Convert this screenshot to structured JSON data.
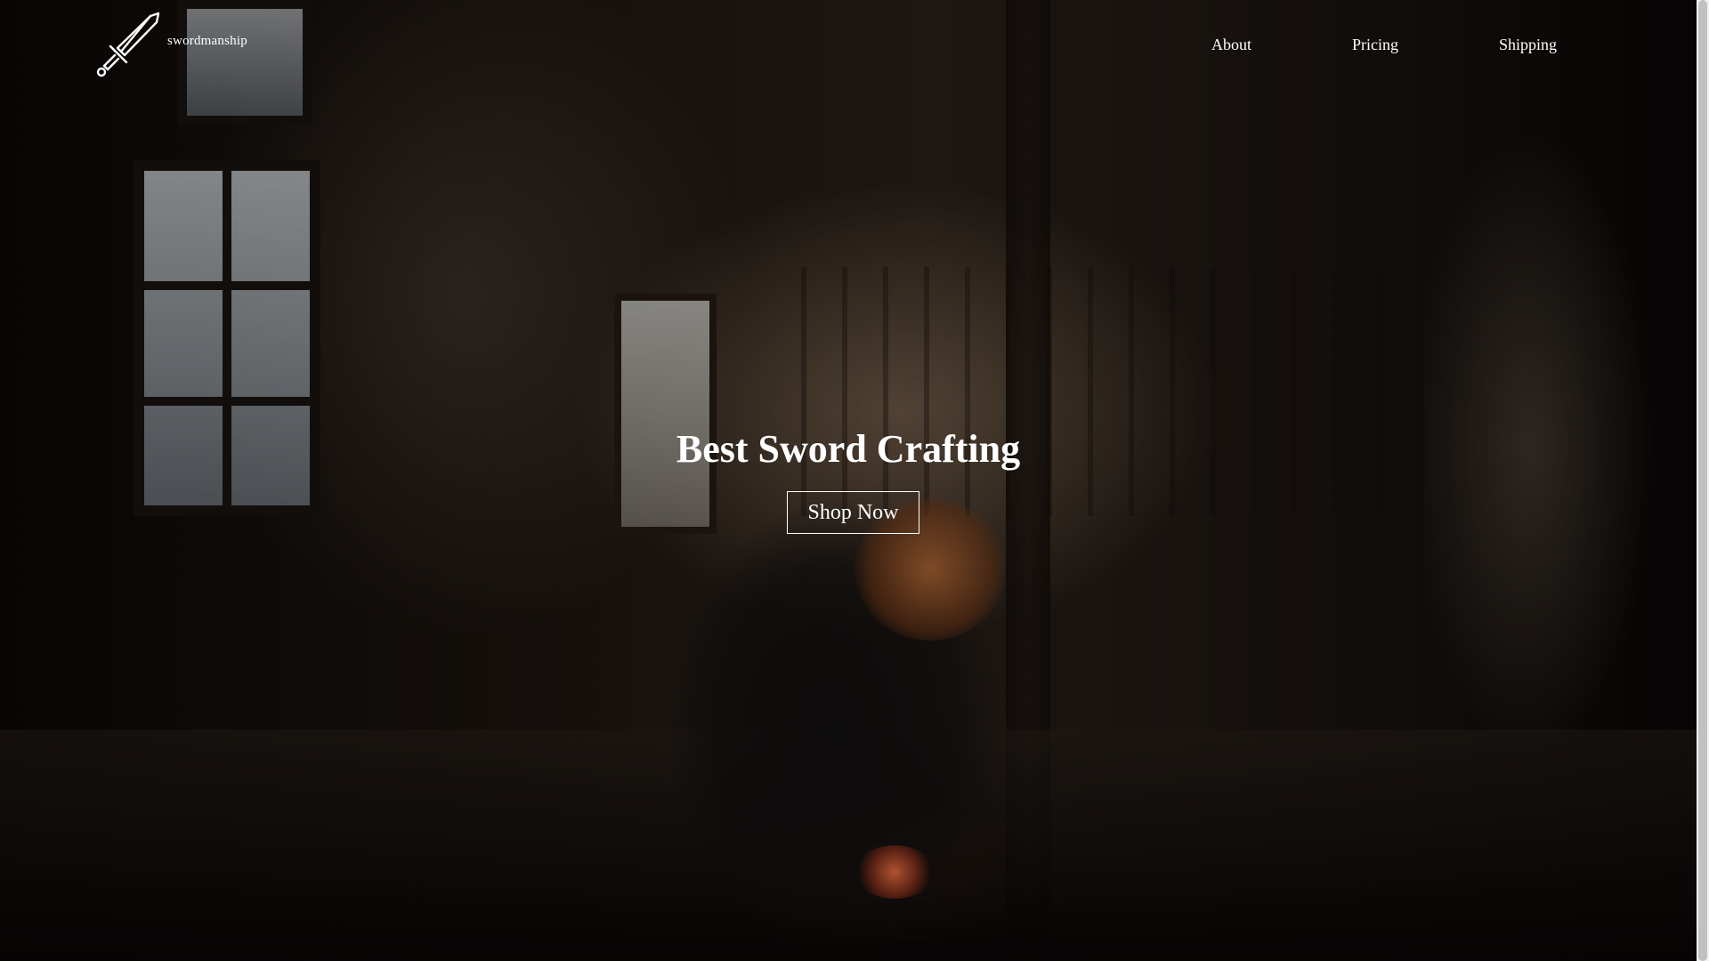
{
  "brand": {
    "name": "swordmanship",
    "logo_icon": "sword-icon",
    "color": "#ffffff"
  },
  "nav": {
    "items": [
      {
        "label": "About"
      },
      {
        "label": "Pricing"
      },
      {
        "label": "Shipping"
      }
    ]
  },
  "hero": {
    "title": "Best Sword Crafting",
    "cta_label": "Shop Now",
    "background": "blacksmith-workshop-photo"
  },
  "colors": {
    "text": "#ffffff",
    "overlay": "#000000",
    "forge_glow": "#ff7846"
  }
}
